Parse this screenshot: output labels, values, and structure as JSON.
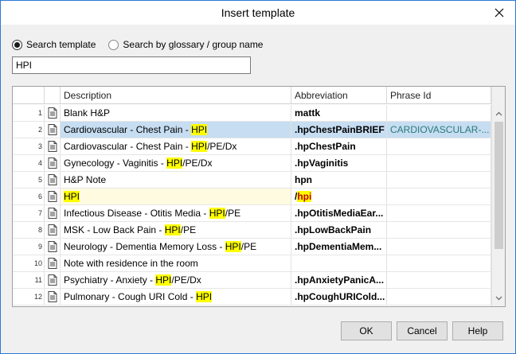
{
  "window": {
    "title": "Insert template"
  },
  "search": {
    "option_template": "Search template",
    "option_glossary": "Search by glossary / group name",
    "value": "HPI"
  },
  "grid": {
    "columns": [
      "Description",
      "Abbreviation",
      "Phrase Id"
    ],
    "rows": [
      {
        "num": "1",
        "desc": [
          {
            "t": "Blank H&P"
          }
        ],
        "abbr": [
          {
            "t": "mattk"
          }
        ],
        "phrase": ""
      },
      {
        "num": "2",
        "desc": [
          {
            "t": "Cardiovascular - Chest Pain - "
          },
          {
            "t": "HPI",
            "hl": true
          }
        ],
        "abbr": [
          {
            "t": ".hpChestPainBRIEF"
          }
        ],
        "phrase": "CARDIOVASCULAR-...",
        "selected": true
      },
      {
        "num": "3",
        "desc": [
          {
            "t": "Cardiovascular - Chest Pain - "
          },
          {
            "t": "HPI",
            "hl": true
          },
          {
            "t": "/PE/Dx"
          }
        ],
        "abbr": [
          {
            "t": ".hpChestPain"
          }
        ],
        "phrase": ""
      },
      {
        "num": "4",
        "desc": [
          {
            "t": "Gynecology - Vaginitis - "
          },
          {
            "t": "HPI",
            "hl": true
          },
          {
            "t": "/PE/Dx"
          }
        ],
        "abbr": [
          {
            "t": ".hpVaginitis"
          }
        ],
        "phrase": ""
      },
      {
        "num": "5",
        "desc": [
          {
            "t": "H&P Note"
          }
        ],
        "abbr": [
          {
            "t": "hpn"
          }
        ],
        "phrase": ""
      },
      {
        "num": "6",
        "desc": [
          {
            "t": "HPI",
            "hl": true
          }
        ],
        "abbr": [
          {
            "t": "/"
          },
          {
            "t": "hpi",
            "hlred": true
          }
        ],
        "phrase": "",
        "hpi": true
      },
      {
        "num": "7",
        "desc": [
          {
            "t": "Infectious Disease - Otitis Media - "
          },
          {
            "t": "HPI",
            "hl": true
          },
          {
            "t": "/PE"
          }
        ],
        "abbr": [
          {
            "t": ".hpOtitisMediaEar..."
          }
        ],
        "phrase": ""
      },
      {
        "num": "8",
        "desc": [
          {
            "t": "MSK - Low Back Pain - "
          },
          {
            "t": "HPI",
            "hl": true
          },
          {
            "t": "/PE"
          }
        ],
        "abbr": [
          {
            "t": ".hpLowBackPain"
          }
        ],
        "phrase": ""
      },
      {
        "num": "9",
        "desc": [
          {
            "t": "Neurology - Dementia Memory Loss - "
          },
          {
            "t": "HPI",
            "hl": true
          },
          {
            "t": "/PE"
          }
        ],
        "abbr": [
          {
            "t": ".hpDementiaMem..."
          }
        ],
        "phrase": ""
      },
      {
        "num": "10",
        "desc": [
          {
            "t": "Note with residence in the room"
          }
        ],
        "abbr": [],
        "phrase": ""
      },
      {
        "num": "11",
        "desc": [
          {
            "t": "Psychiatry - Anxiety - "
          },
          {
            "t": "HPI",
            "hl": true
          },
          {
            "t": "/PE/Dx"
          }
        ],
        "abbr": [
          {
            "t": ".hpAnxietyPanicA..."
          }
        ],
        "phrase": ""
      },
      {
        "num": "12",
        "desc": [
          {
            "t": "Pulmonary - Cough URI Cold - "
          },
          {
            "t": "HPI",
            "hl": true
          }
        ],
        "abbr": [
          {
            "t": ".hpCoughURICold..."
          }
        ],
        "phrase": ""
      }
    ]
  },
  "buttons": {
    "ok": "OK",
    "cancel": "Cancel",
    "help": "Help"
  }
}
